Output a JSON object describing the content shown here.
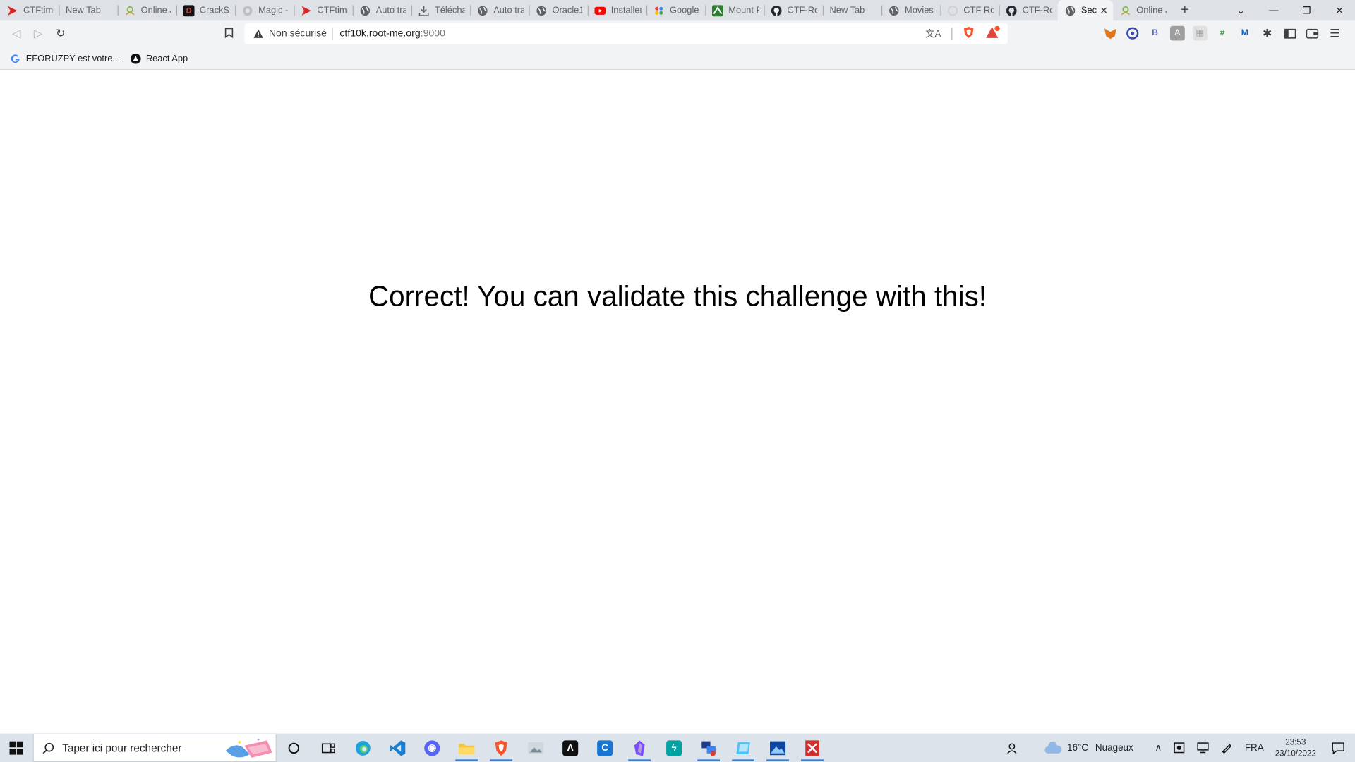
{
  "tabs": [
    {
      "title": "CTFtime",
      "icon": "ctftime-icon",
      "color": "#e02020"
    },
    {
      "title": "New Tab",
      "icon": "",
      "color": ""
    },
    {
      "title": "Online Ja",
      "icon": "online-icon",
      "color": "#7cb342"
    },
    {
      "title": "CrackSta",
      "icon": "crackstation-icon",
      "color": "#c62828"
    },
    {
      "title": "Magic -",
      "icon": "magic-icon",
      "color": "#9e9e9e"
    },
    {
      "title": "CTFtime",
      "icon": "ctftime-icon",
      "color": "#e02020"
    },
    {
      "title": "Auto tra",
      "icon": "globe-icon",
      "color": "#5f6368"
    },
    {
      "title": "Téléchar",
      "icon": "download-icon",
      "color": "#5f6368"
    },
    {
      "title": "Auto tra",
      "icon": "globe-icon",
      "color": "#5f6368"
    },
    {
      "title": "Oracle1",
      "icon": "globe-icon",
      "color": "#5f6368"
    },
    {
      "title": "Installer",
      "icon": "youtube-icon",
      "color": "#ff0000"
    },
    {
      "title": "Google L",
      "icon": "google-lens-icon",
      "color": "#4285f4"
    },
    {
      "title": "Mount F",
      "icon": "mount-icon",
      "color": "#2e7d32"
    },
    {
      "title": "CTF-Roo",
      "icon": "github-icon",
      "color": "#24292f"
    },
    {
      "title": "New Tab",
      "icon": "",
      "color": ""
    },
    {
      "title": "Movies F",
      "icon": "globe-icon",
      "color": "#5f6368"
    },
    {
      "title": "CTF Roo",
      "icon": "ctfroot-icon",
      "color": "#cfcfcf"
    },
    {
      "title": "CTF-Roo",
      "icon": "github-icon",
      "color": "#24292f"
    },
    {
      "title": "Secu",
      "icon": "globe-icon",
      "color": "#5f6368",
      "active": true
    },
    {
      "title": "Online Ja",
      "icon": "online-icon",
      "color": "#7cb342"
    }
  ],
  "address_bar": {
    "security_label": "Non sécurisé",
    "host": "ctf10k.root-me.org",
    "port": ":9000"
  },
  "bookmarks": [
    {
      "label": "EFORUZPY est votre...",
      "icon": "google-icon"
    },
    {
      "label": "React App",
      "icon": "react-app-icon"
    }
  ],
  "page": {
    "message": "Correct! You can validate this challenge with this!"
  },
  "taskbar": {
    "search_placeholder": "Taper ici pour rechercher",
    "weather_temp": "16°C",
    "weather_text": "Nuageux",
    "language": "FRA",
    "time": "23:53",
    "date": "23/10/2022"
  }
}
